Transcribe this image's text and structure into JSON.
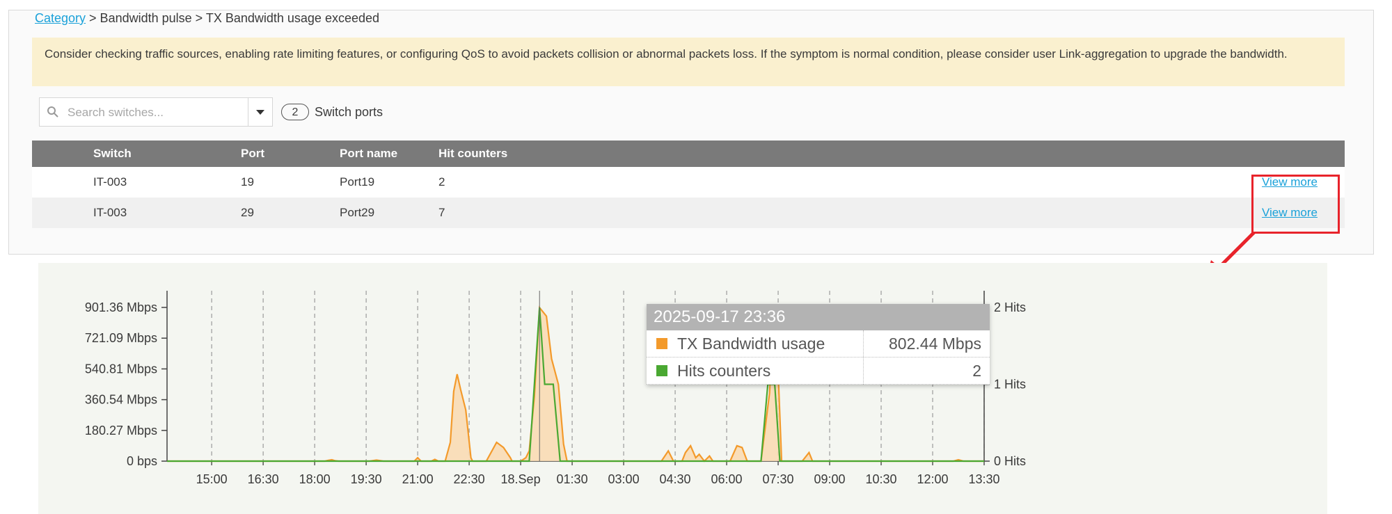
{
  "breadcrumb": {
    "root": "Category",
    "rest": " > Bandwidth pulse > TX Bandwidth usage exceeded"
  },
  "notice": "Consider checking traffic sources, enabling rate limiting features, or configuring QoS to avoid packets collision or abnormal packets loss. If the symptom is normal condition, please consider user Link-aggregation to upgrade the bandwidth.",
  "search": {
    "placeholder": "Search switches..."
  },
  "switch_ports": {
    "count": "2",
    "label": "Switch ports"
  },
  "table": {
    "headers": {
      "switch": "Switch",
      "port": "Port",
      "port_name": "Port name",
      "hit_counters": "Hit counters"
    },
    "rows": [
      {
        "switch": "IT-003",
        "port": "19",
        "port_name": "Port19",
        "hits": "2",
        "action": "View more"
      },
      {
        "switch": "IT-003",
        "port": "29",
        "port_name": "Port29",
        "hits": "7",
        "action": "View more"
      }
    ]
  },
  "tooltip": {
    "time": "2025-09-17 23:36",
    "rows": [
      {
        "label": "TX Bandwidth usage",
        "value": "802.44 Mbps"
      },
      {
        "label": "Hits counters",
        "value": "2"
      }
    ]
  },
  "colors": {
    "bandwidth": "#f39a2b",
    "bandwidth_fill": "#f9d9b0",
    "hits": "#4aa832",
    "link": "#1aa1d9",
    "highlight": "#e8232b"
  },
  "chart_data": {
    "type": "area",
    "x_ticks": [
      "15:00",
      "16:30",
      "18:00",
      "19:30",
      "21:00",
      "22:30",
      "18.Sep",
      "01:30",
      "03:00",
      "04:30",
      "06:00",
      "07:30",
      "09:00",
      "10:30",
      "12:00",
      "13:30"
    ],
    "y_left_ticks": [
      "0 bps",
      "180.27 Mbps",
      "360.54 Mbps",
      "540.81 Mbps",
      "721.09 Mbps",
      "901.36 Mbps"
    ],
    "y_left_range_mbps": [
      0,
      901.36
    ],
    "y_right_ticks": [
      "0 Hits",
      "1 Hits",
      "2 Hits"
    ],
    "y_right_range": [
      0,
      2
    ],
    "x_range_hours": [
      -1.3,
      22.5
    ],
    "grid": "vertical dashed",
    "series": [
      {
        "name": "TX Bandwidth usage",
        "axis": "left",
        "points": [
          [
            -1.3,
            0
          ],
          [
            3.3,
            0
          ],
          [
            3.4,
            5
          ],
          [
            3.5,
            8
          ],
          [
            3.6,
            2
          ],
          [
            3.7,
            0
          ],
          [
            4.6,
            0
          ],
          [
            4.8,
            6
          ],
          [
            5.0,
            0
          ],
          [
            5.9,
            0
          ],
          [
            6.0,
            20
          ],
          [
            6.1,
            0
          ],
          [
            6.4,
            0
          ],
          [
            6.5,
            10
          ],
          [
            6.6,
            0
          ],
          [
            6.8,
            0
          ],
          [
            6.95,
            110
          ],
          [
            7.05,
            410
          ],
          [
            7.15,
            510
          ],
          [
            7.25,
            420
          ],
          [
            7.4,
            300
          ],
          [
            7.55,
            20
          ],
          [
            7.6,
            0
          ],
          [
            8.0,
            0
          ],
          [
            8.3,
            110
          ],
          [
            8.5,
            80
          ],
          [
            8.7,
            20
          ],
          [
            8.75,
            0
          ],
          [
            9.0,
            0
          ],
          [
            9.15,
            20
          ],
          [
            9.25,
            60
          ],
          [
            9.4,
            380
          ],
          [
            9.55,
            900
          ],
          [
            9.75,
            850
          ],
          [
            9.9,
            600
          ],
          [
            10.1,
            450
          ],
          [
            10.25,
            100
          ],
          [
            10.35,
            0
          ],
          [
            13.1,
            0
          ],
          [
            13.3,
            60
          ],
          [
            13.45,
            0
          ],
          [
            13.7,
            0
          ],
          [
            13.8,
            50
          ],
          [
            13.95,
            90
          ],
          [
            14.1,
            20
          ],
          [
            14.2,
            40
          ],
          [
            14.35,
            0
          ],
          [
            14.5,
            30
          ],
          [
            14.6,
            0
          ],
          [
            15.1,
            0
          ],
          [
            15.3,
            90
          ],
          [
            15.45,
            80
          ],
          [
            15.6,
            0
          ],
          [
            16.0,
            0
          ],
          [
            16.25,
            400
          ],
          [
            16.35,
            820
          ],
          [
            16.45,
            780
          ],
          [
            16.6,
            0
          ],
          [
            17.2,
            0
          ],
          [
            17.4,
            50
          ],
          [
            17.5,
            0
          ],
          [
            21.6,
            0
          ],
          [
            21.75,
            8
          ],
          [
            21.9,
            0
          ],
          [
            22.5,
            0
          ]
        ]
      },
      {
        "name": "Hits counters",
        "axis": "right",
        "points": [
          [
            -1.3,
            0
          ],
          [
            9.25,
            0
          ],
          [
            9.55,
            2
          ],
          [
            9.7,
            1
          ],
          [
            9.95,
            1
          ],
          [
            10.15,
            0
          ],
          [
            16.0,
            0
          ],
          [
            16.2,
            1
          ],
          [
            16.4,
            1
          ],
          [
            16.55,
            0
          ],
          [
            22.5,
            0
          ]
        ]
      }
    ]
  }
}
